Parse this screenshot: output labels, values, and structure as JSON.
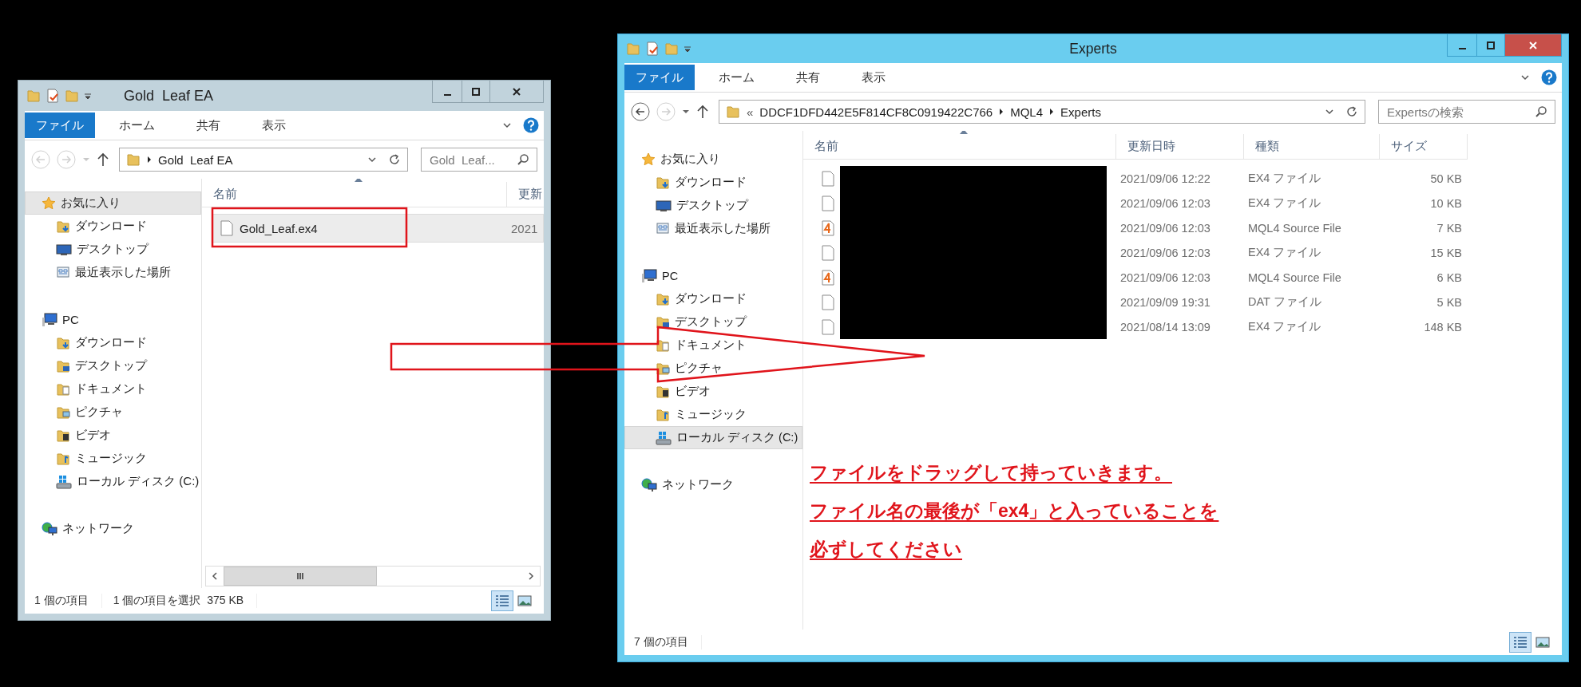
{
  "windows": [
    {
      "title": "Gold  Leaf EA",
      "active": false,
      "ribbon_tabs": [
        {
          "label": "ファイル",
          "selected": true
        },
        {
          "label": "ホーム",
          "selected": false
        },
        {
          "label": "共有",
          "selected": false
        },
        {
          "label": "表示",
          "selected": false
        }
      ],
      "back": {
        "disabled": true
      },
      "forward": {
        "disabled": true
      },
      "address": {
        "crumbs": [
          "Gold  Leaf EA"
        ]
      },
      "search": {
        "placeholder": "Gold  Leaf..."
      },
      "nav": [
        {
          "label": "お気に入り",
          "kind": "star",
          "selected": true,
          "children": [
            {
              "label": "ダウンロード",
              "kind": "downloads",
              "selected": false
            },
            {
              "label": "デスクトップ",
              "kind": "desktop",
              "selected": false
            },
            {
              "label": "最近表示した場所",
              "kind": "recent",
              "selected": false
            }
          ]
        },
        {
          "label": "PC",
          "kind": "pc",
          "selected": false,
          "children": [
            {
              "label": "ダウンロード",
              "kind": "downloads",
              "selected": false
            },
            {
              "label": "デスクトップ",
              "kind": "desktop-folder",
              "selected": false
            },
            {
              "label": "ドキュメント",
              "kind": "documents",
              "selected": false
            },
            {
              "label": "ピクチャ",
              "kind": "pictures",
              "selected": false
            },
            {
              "label": "ビデオ",
              "kind": "videos",
              "selected": false
            },
            {
              "label": "ミュージック",
              "kind": "music",
              "selected": false
            },
            {
              "label": "ローカル ディスク (C:)",
              "kind": "disk",
              "selected": false
            }
          ]
        },
        {
          "label": "ネットワーク",
          "kind": "network",
          "selected": false
        }
      ],
      "name_column": "名前",
      "columns": [
        "更新"
      ],
      "rows": [
        {
          "kind": "file",
          "selected": true,
          "name": "Gold_Leaf.ex4",
          "cells": [
            "2021"
          ]
        }
      ],
      "horizontal_scrollbar": true,
      "status": [
        "1 個の項目",
        "1 個の項目を選択  375 KB"
      ]
    },
    {
      "title": "Experts",
      "active": true,
      "ribbon_tabs": [
        {
          "label": "ファイル",
          "selected": true
        },
        {
          "label": "ホーム",
          "selected": false
        },
        {
          "label": "共有",
          "selected": false
        },
        {
          "label": "表示",
          "selected": false
        }
      ],
      "back": {
        "disabled": false
      },
      "forward": {
        "disabled": true
      },
      "address": {
        "overflow": "«",
        "crumbs": [
          "DDCF1DFD442E5F814CF8C0919422C766",
          "MQL4",
          "Experts"
        ]
      },
      "search": {
        "placeholder": "Expertsの検索"
      },
      "nav": [
        {
          "label": "お気に入り",
          "kind": "star",
          "selected": false,
          "children": [
            {
              "label": "ダウンロード",
              "kind": "downloads",
              "selected": false
            },
            {
              "label": "デスクトップ",
              "kind": "desktop",
              "selected": false
            },
            {
              "label": "最近表示した場所",
              "kind": "recent",
              "selected": false
            }
          ]
        },
        {
          "label": "PC",
          "kind": "pc",
          "selected": false,
          "children": [
            {
              "label": "ダウンロード",
              "kind": "downloads",
              "selected": false
            },
            {
              "label": "デスクトップ",
              "kind": "desktop-folder",
              "selected": false
            },
            {
              "label": "ドキュメント",
              "kind": "documents",
              "selected": false
            },
            {
              "label": "ピクチャ",
              "kind": "pictures",
              "selected": false
            },
            {
              "label": "ビデオ",
              "kind": "videos",
              "selected": false
            },
            {
              "label": "ミュージック",
              "kind": "music",
              "selected": false
            },
            {
              "label": "ローカル ディスク (C:)",
              "kind": "disk",
              "selected": true
            }
          ]
        },
        {
          "label": "ネットワーク",
          "kind": "network",
          "selected": false
        }
      ],
      "name_column": "名前",
      "columns": [
        "更新日時",
        "種類",
        "サイズ"
      ],
      "names_redacted": true,
      "rows": [
        {
          "kind": "file",
          "selected": false,
          "cells": [
            "2021/09/06 12:22",
            "EX4 ファイル",
            "50 KB"
          ]
        },
        {
          "kind": "file",
          "selected": false,
          "cells": [
            "2021/09/06 12:03",
            "EX4 ファイル",
            "10 KB"
          ]
        },
        {
          "kind": "source",
          "selected": false,
          "cells": [
            "2021/09/06 12:03",
            "MQL4 Source File",
            "7 KB"
          ]
        },
        {
          "kind": "file",
          "selected": false,
          "cells": [
            "2021/09/06 12:03",
            "EX4 ファイル",
            "15 KB"
          ]
        },
        {
          "kind": "source",
          "selected": false,
          "cells": [
            "2021/09/06 12:03",
            "MQL4 Source File",
            "6 KB"
          ]
        },
        {
          "kind": "file",
          "selected": false,
          "cells": [
            "2021/09/09 19:31",
            "DAT ファイル",
            "5 KB"
          ]
        },
        {
          "kind": "file",
          "selected": false,
          "cells": [
            "2021/08/14 13:09",
            "EX4 ファイル",
            "148 KB"
          ]
        }
      ],
      "annotation": [
        "ファイルをドラッグして持っていきます。",
        "ファイル名の最後が「ex4」と入っていることを",
        "必ずしてください"
      ],
      "status": [
        "7 個の項目"
      ]
    }
  ]
}
